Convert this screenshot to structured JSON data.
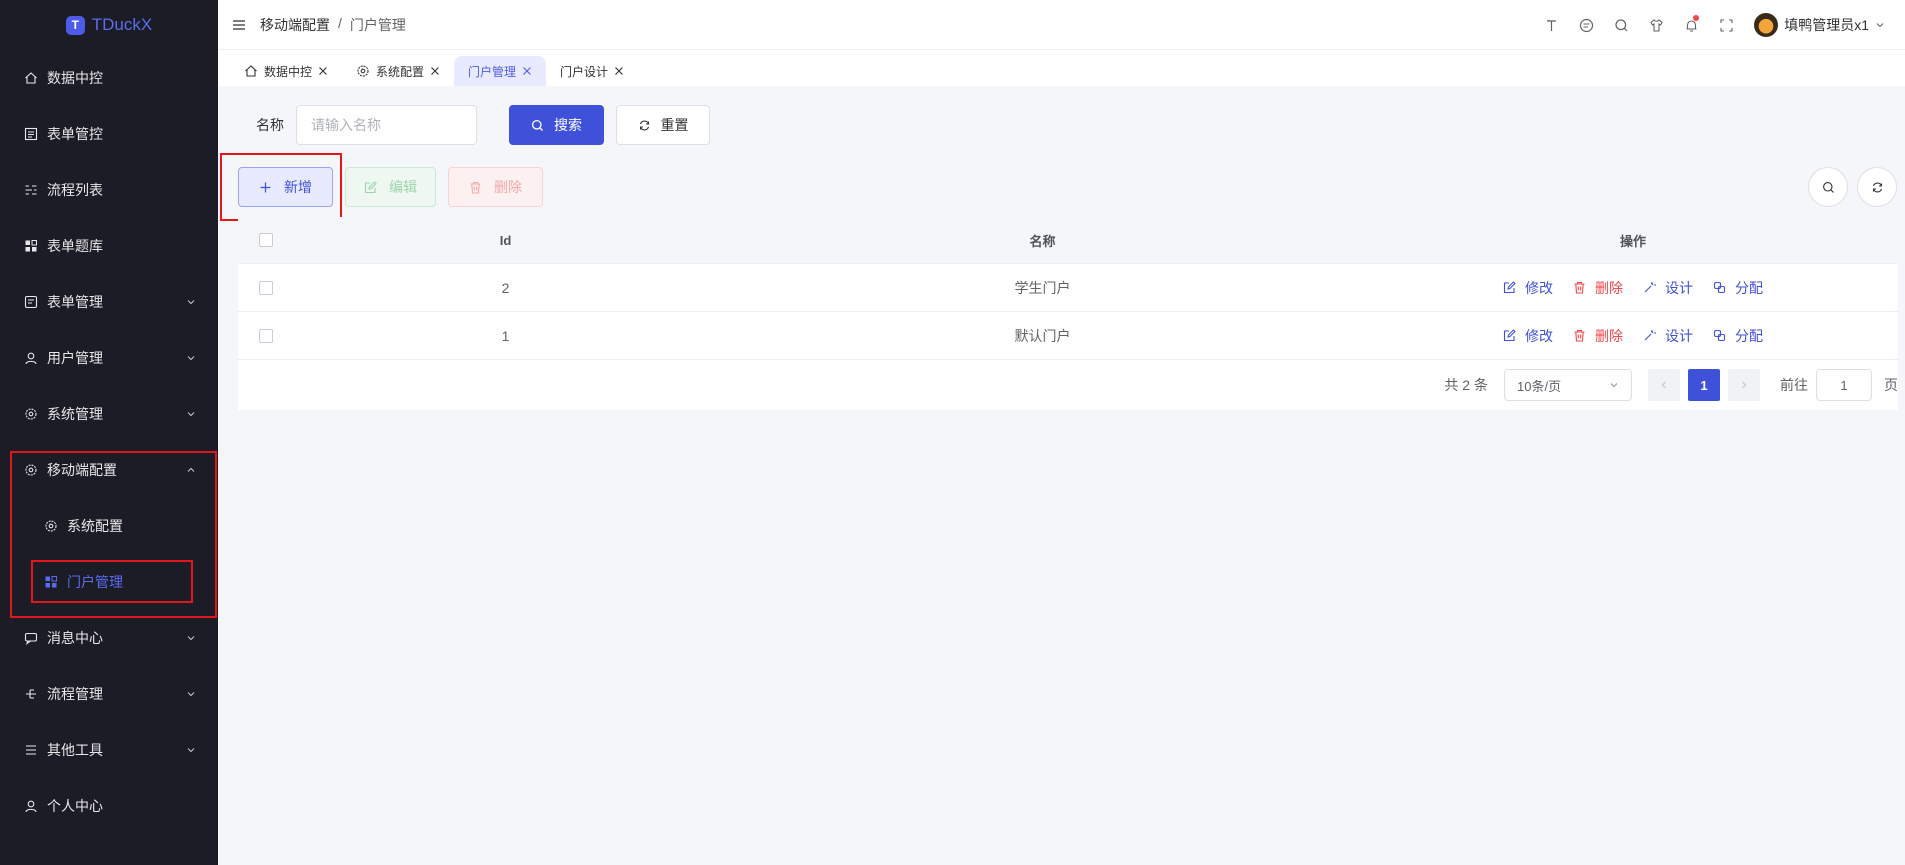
{
  "app": {
    "logo_letter": "T",
    "title": "TDuckX"
  },
  "sidebar": {
    "items": [
      {
        "label": "数据中控",
        "icon": "home-icon"
      },
      {
        "label": "表单管控",
        "icon": "form-icon"
      },
      {
        "label": "流程列表",
        "icon": "flow-list-icon"
      },
      {
        "label": "表单题库",
        "icon": "grid-icon"
      },
      {
        "label": "表单管理",
        "icon": "form-manage-icon"
      },
      {
        "label": "用户管理",
        "icon": "user-icon"
      },
      {
        "label": "系统管理",
        "icon": "gear-icon"
      },
      {
        "label": "移动端配置",
        "icon": "gear-icon"
      },
      {
        "label": "系统配置",
        "icon": "gear-icon"
      },
      {
        "label": "门户管理",
        "icon": "grid-icon"
      },
      {
        "label": "消息中心",
        "icon": "message-icon"
      },
      {
        "label": "流程管理",
        "icon": "flow-icon"
      },
      {
        "label": "其他工具",
        "icon": "list-icon"
      },
      {
        "label": "个人中心",
        "icon": "user-icon"
      }
    ]
  },
  "header": {
    "breadcrumb": [
      "移动端配置",
      "/",
      "门户管理"
    ],
    "user_name": "填鸭管理员x1"
  },
  "tabs": [
    {
      "label": "数据中控",
      "active": false
    },
    {
      "label": "系统配置",
      "active": false
    },
    {
      "label": "门户管理",
      "active": true
    },
    {
      "label": "门户设计",
      "active": false
    }
  ],
  "search": {
    "name_label": "名称",
    "name_placeholder": "请输入名称",
    "search_button": "搜索",
    "reset_button": "重置"
  },
  "actions": {
    "add": "新增",
    "edit": "编辑",
    "delete": "删除"
  },
  "table": {
    "columns": [
      "Id",
      "名称",
      "操作"
    ],
    "rows": [
      {
        "id": "2",
        "name": "学生门户"
      },
      {
        "id": "1",
        "name": "默认门户"
      }
    ],
    "row_ops": [
      "修改",
      "删除",
      "设计",
      "分配"
    ]
  },
  "pagination": {
    "total_text": "共 2 条",
    "page_size": "10条/页",
    "current_page": "1",
    "goto_label": "前往",
    "goto_value": "1",
    "page_suffix": "页"
  },
  "colors": {
    "primary": "#4051d9",
    "sidebar_bg": "#1b1c25",
    "danger": "#f04848",
    "highlight": "#e3161a"
  }
}
